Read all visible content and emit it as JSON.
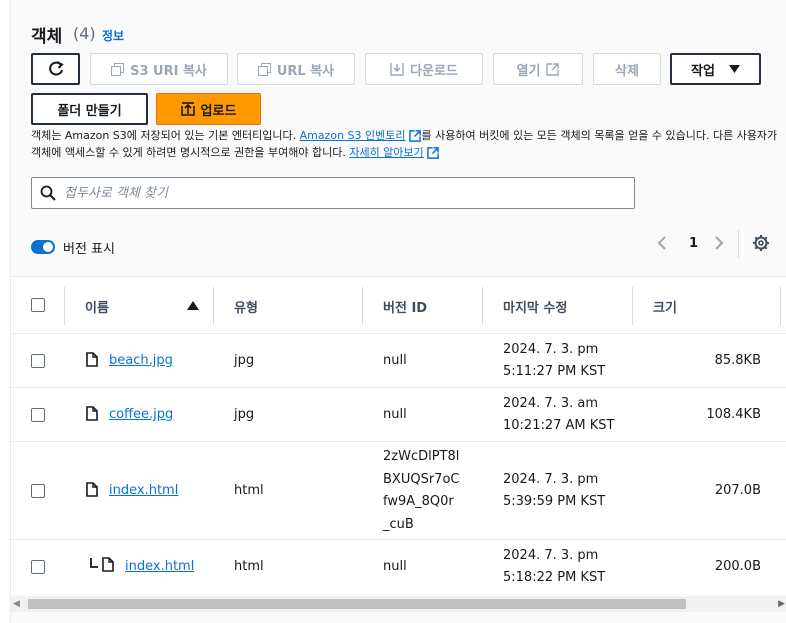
{
  "header": {
    "title": "객체",
    "count": "(4)",
    "info": "정보"
  },
  "toolbar": {
    "refresh_icon": "refresh-icon",
    "copy_s3_uri": "S3 URI 복사",
    "copy_url": "URL 복사",
    "download": "다운로드",
    "open": "열기",
    "delete": "삭제",
    "actions": "작업",
    "create_folder": "폴더 만들기",
    "upload": "업로드"
  },
  "description": {
    "part1": "객체는 Amazon S3에 저장되어 있는 기본 엔터티입니다. ",
    "link1": "Amazon S3 인벤토리",
    "part2": "를 사용하여 버킷에 있는 모든 객체의 목록을 얻을 수 있습니다. 다른 사용자가 객체에 액세스할 수 있게 하려면 명시적으로 권한을 부여해야 합니다. ",
    "link2": "자세히 알아보기"
  },
  "search": {
    "placeholder": "접두사로 객체 찾기",
    "value": ""
  },
  "versions_toggle": {
    "label": "버전 표시",
    "on": true
  },
  "pagination": {
    "page": "1"
  },
  "table": {
    "columns": {
      "name": "이름",
      "type": "유형",
      "version_id": "버전 ID",
      "modified": "마지막 수정",
      "size": "크기"
    },
    "rows": [
      {
        "name": "beach.jpg",
        "type": "jpg",
        "version": "null",
        "date": "2024. 7. 3. pm",
        "time": "5:11:27 PM KST",
        "size": "85.8KB"
      },
      {
        "name": "coffee.jpg",
        "type": "jpg",
        "version": "null",
        "date": "2024. 7. 3. am",
        "time": "10:21:27 AM KST",
        "size": "108.4KB"
      },
      {
        "name": "index.html",
        "type": "html",
        "version_lines": [
          "2zWcDlPT8l",
          "BXUQSr7oC",
          "fw9A_8Q0r",
          "_cuB"
        ],
        "date": "2024. 7. 3. pm",
        "time": "5:39:59 PM KST",
        "size": "207.0B"
      },
      {
        "name": "index.html",
        "type": "html",
        "version": "null",
        "date": "2024. 7. 3. pm",
        "time": "5:18:22 PM KST",
        "size": "200.0B"
      }
    ]
  },
  "colors": {
    "accent": "#0972d3",
    "primary_button": "#ff9900",
    "text": "#16191f"
  }
}
